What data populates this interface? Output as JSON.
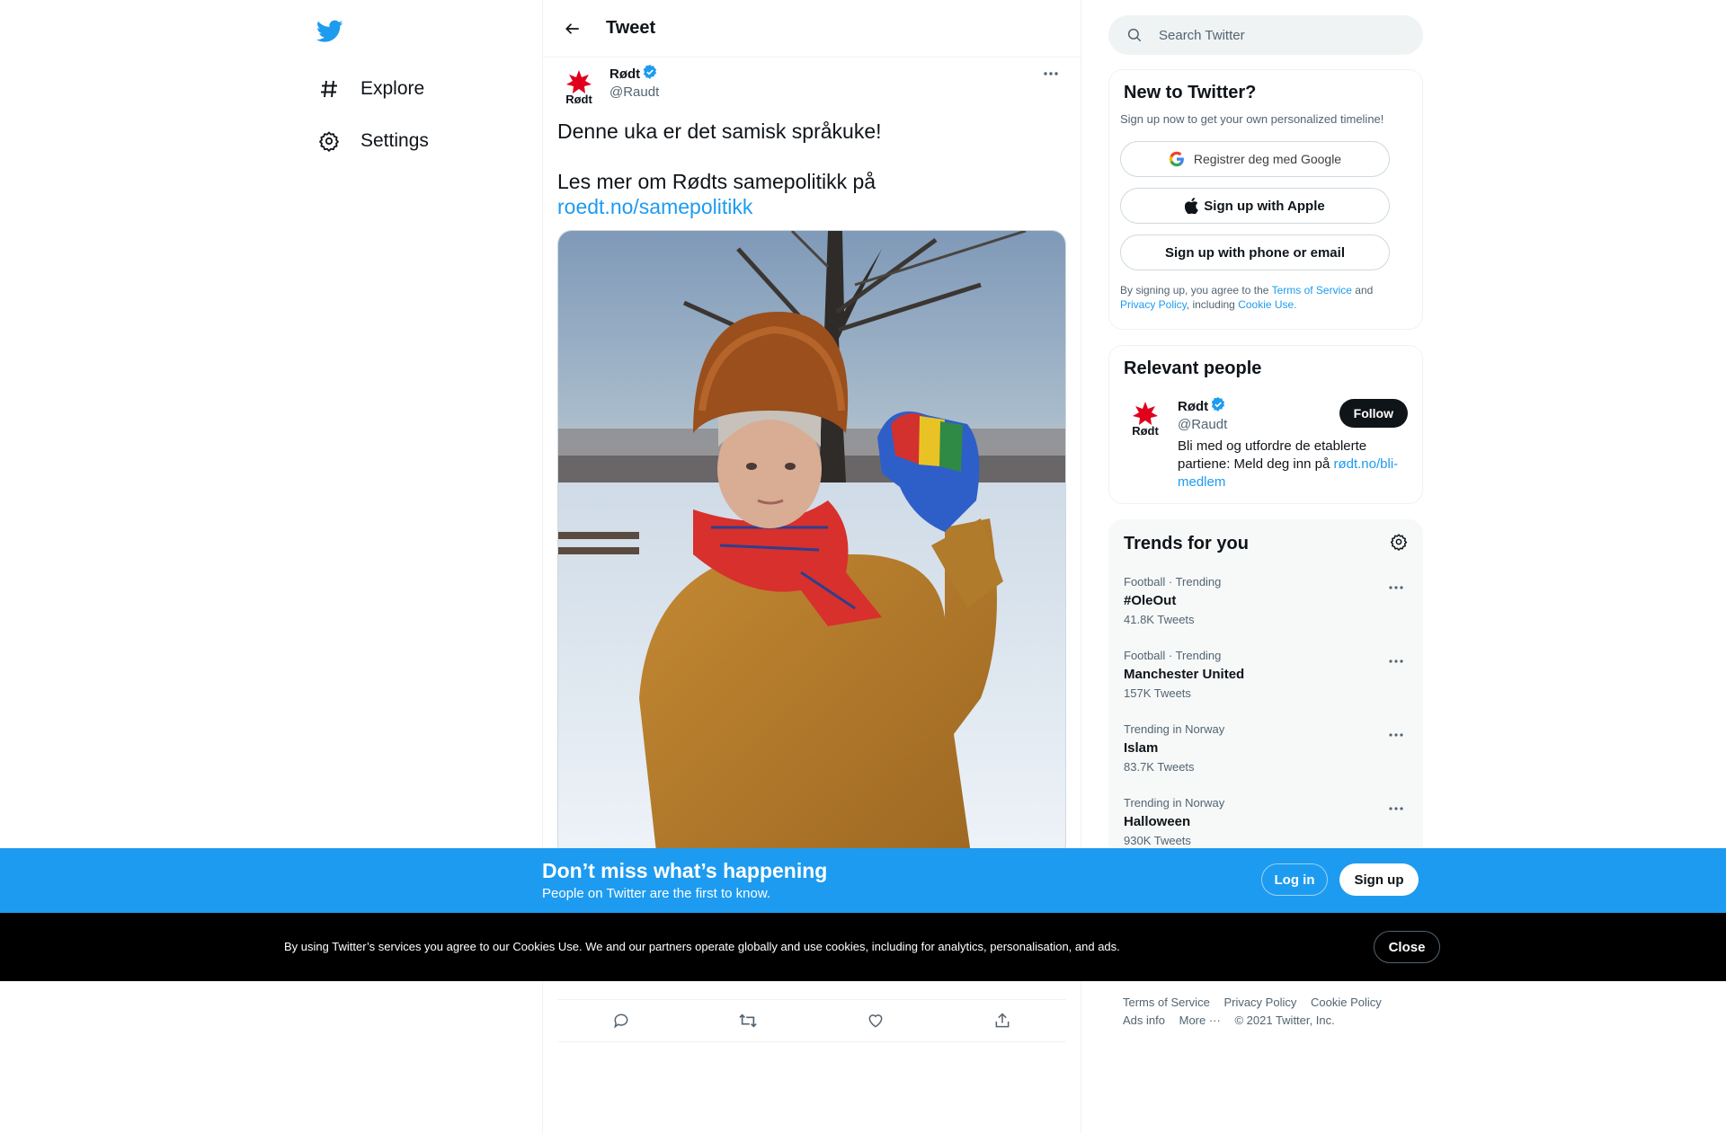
{
  "nav": {
    "logo_icon": "twitter-bird-icon",
    "items": [
      {
        "label": "Explore",
        "icon": "hashtag-icon"
      },
      {
        "label": "Settings",
        "icon": "gear-icon"
      }
    ]
  },
  "header": {
    "title": "Tweet",
    "back_icon": "arrow-left-icon"
  },
  "tweet": {
    "author_name": "Rødt",
    "author_handle": "@Raudt",
    "avatar_text": "Rødt",
    "verified": true,
    "text_line1": "Denne uka er det samisk språkuke!",
    "text_line2": "Les mer om Rødts samepolitikk på",
    "link": "roedt.no/samepolitikk",
    "media_alt": "Woman in fur hat, red scarf and blue Sami mittens raising her fist in a snowy park"
  },
  "search": {
    "placeholder": "Search Twitter"
  },
  "new_to_twitter": {
    "title": "New to Twitter?",
    "subtitle": "Sign up now to get your own personalized timeline!",
    "google_label": "Registrer deg med Google",
    "apple_label": "Sign up with Apple",
    "phone_label": "Sign up with phone or email",
    "legal_prefix": "By signing up, you agree to the",
    "terms": "Terms of Service",
    "and": "and",
    "privacy": "Privacy Policy",
    "including": ", including",
    "cookie": "Cookie Use."
  },
  "relevant_people": {
    "title": "Relevant people",
    "person": {
      "name": "Rødt",
      "handle": "@Raudt",
      "bio": "Bli med og utfordre de etablerte partiene: Meld deg inn på",
      "bio_link": "rødt.no/bli-medlem",
      "follow_label": "Follow"
    }
  },
  "trends": {
    "title": "Trends for you",
    "items": [
      {
        "meta": "Football · Trending",
        "name": "#OleOut",
        "count": "41.8K Tweets"
      },
      {
        "meta": "Football · Trending",
        "name": "Manchester United",
        "count": "157K Tweets"
      },
      {
        "meta": "Trending in Norway",
        "name": "Islam",
        "count": "83.7K Tweets"
      },
      {
        "meta": "Trending in Norway",
        "name": "Halloween",
        "count": "930K Tweets"
      }
    ]
  },
  "footer": {
    "terms": "Terms of Service",
    "privacy": "Privacy Policy",
    "cookie": "Cookie Policy",
    "ads": "Ads info",
    "more": "More ···",
    "copyright": "© 2021 Twitter, Inc."
  },
  "signup_bar": {
    "title": "Don’t miss what’s happening",
    "subtitle": "People on Twitter are the first to know.",
    "login": "Log in",
    "signup": "Sign up"
  },
  "cookie_bar": {
    "text": "By using Twitter’s services you agree to our Cookies Use. We and our partners operate globally and use cookies, including for analytics, personalisation, and ads.",
    "close": "Close"
  },
  "colors": {
    "accent": "#1d9bf0",
    "text": "#0f1419",
    "muted": "#536471",
    "cookie_bg": "#000000"
  }
}
